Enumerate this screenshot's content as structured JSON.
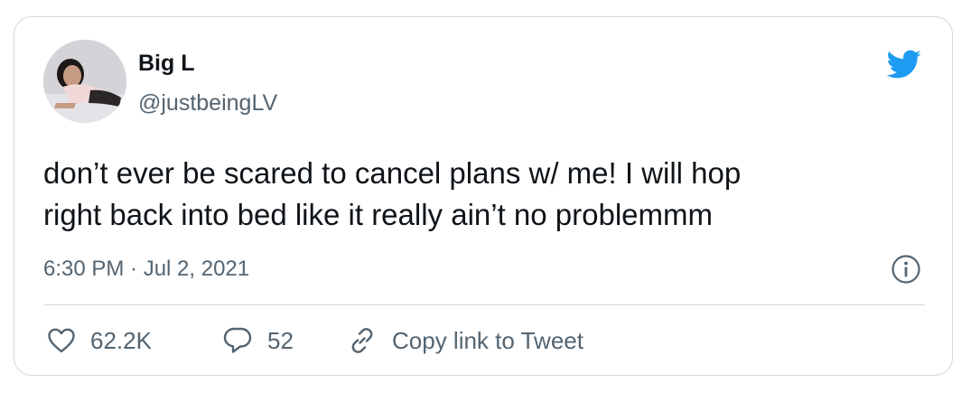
{
  "author": {
    "name": "Big L",
    "handle": "@justbeingLV"
  },
  "tweet": {
    "text_lines": [
      "don’t ever be scared to cancel plans w/ me! I will hop",
      "right back into bed like it really ain’t no problemmm"
    ],
    "timestamp": "6:30 PM · Jul 2, 2021"
  },
  "actions": {
    "likes": "62.2K",
    "replies": "52",
    "copy_link_label": "Copy link to Tweet"
  },
  "icons": {
    "brand": "twitter-bird-icon",
    "info": "info-icon",
    "like": "heart-icon",
    "reply": "reply-bubble-icon",
    "copy_link": "link-icon"
  },
  "colors": {
    "brand_blue": "#1d9bf0",
    "text_primary": "#0f1419",
    "text_secondary": "#536471",
    "border": "#cfd9de"
  }
}
